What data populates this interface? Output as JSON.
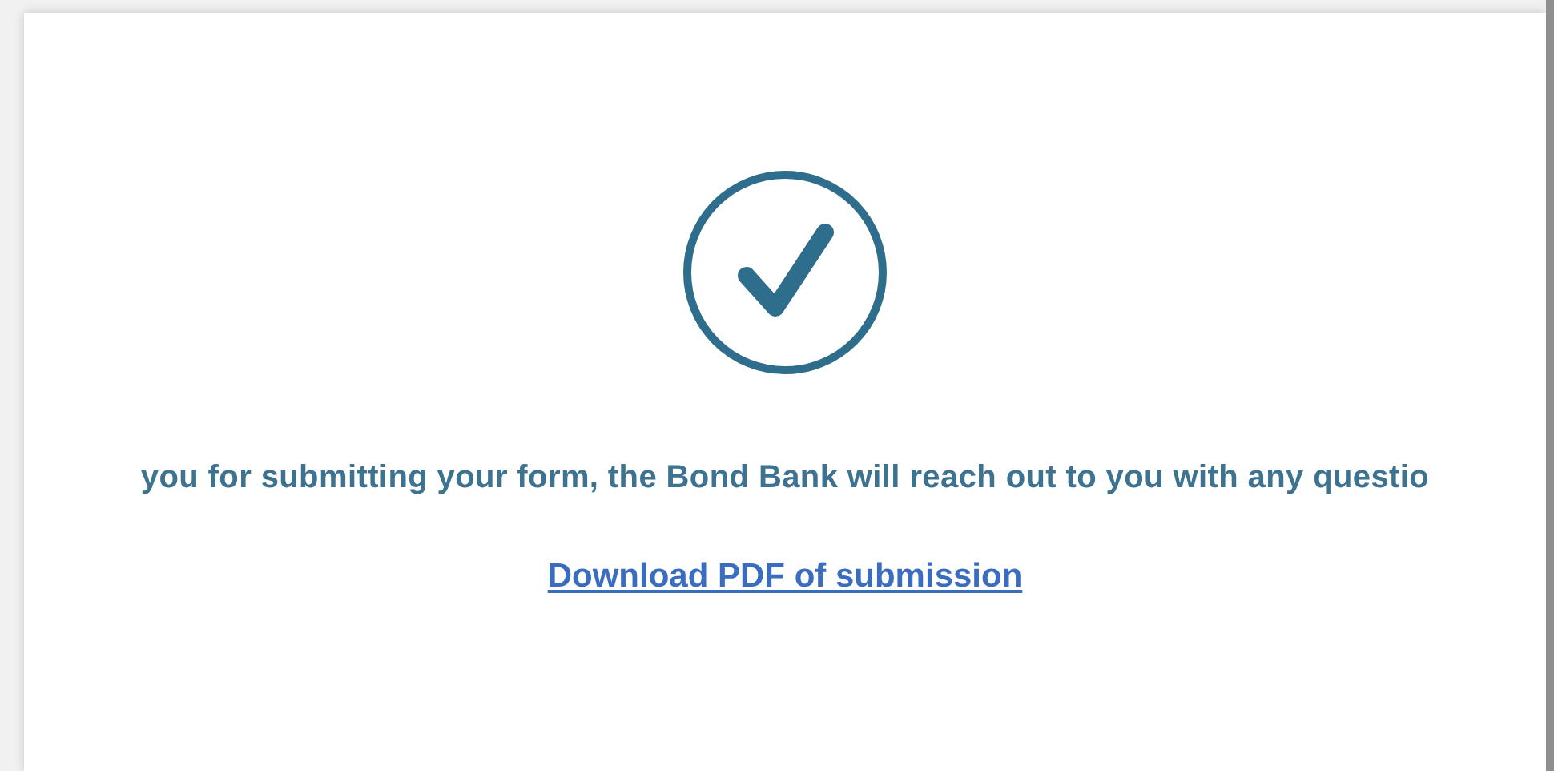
{
  "confirmation": {
    "message": "you for submitting your form, the Bond Bank will reach out to you with any questio",
    "download_link": "Download PDF of submission"
  }
}
